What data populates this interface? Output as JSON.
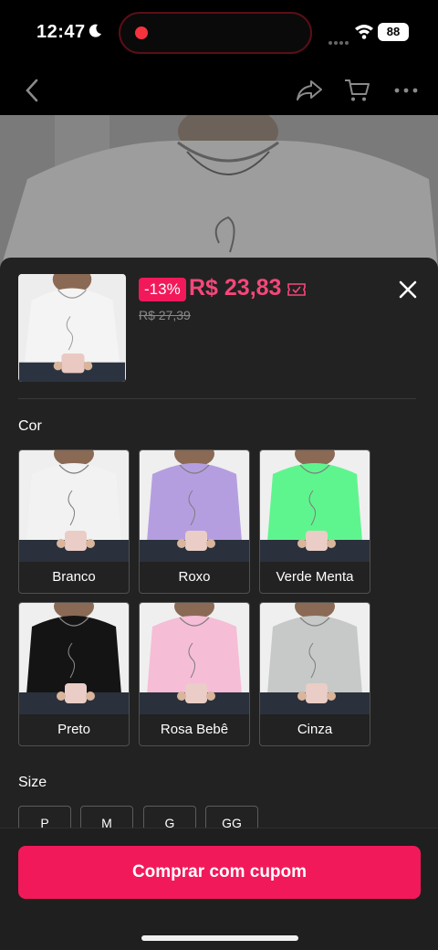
{
  "status_bar": {
    "time": "12:47",
    "battery": "88",
    "recording_color": "#f4333f"
  },
  "nav": {
    "back_icon": "chevron-left-icon",
    "share_icon": "share-icon",
    "cart_icon": "cart-icon",
    "more_icon": "more-icon"
  },
  "product": {
    "discount": "-13%",
    "price": "R$ 23,83",
    "old_price": "R$ 27,39",
    "coupon_icon": "coupon-icon"
  },
  "colors": {
    "label": "Cor",
    "options": [
      {
        "name": "Branco",
        "shirt": "#f2f2f2"
      },
      {
        "name": "Roxo",
        "shirt": "#b59ee0"
      },
      {
        "name": "Verde Menta",
        "shirt": "#5ff58e"
      },
      {
        "name": "Preto",
        "shirt": "#141414"
      },
      {
        "name": "Rosa Bebê",
        "shirt": "#f6bdd6"
      },
      {
        "name": "Cinza",
        "shirt": "#c6c9c7"
      }
    ]
  },
  "sizes": {
    "label": "Size",
    "options": [
      "P",
      "M",
      "G",
      "GG"
    ]
  },
  "actions": {
    "buy_label": "Comprar com cupom",
    "accent": "#f2195a"
  }
}
